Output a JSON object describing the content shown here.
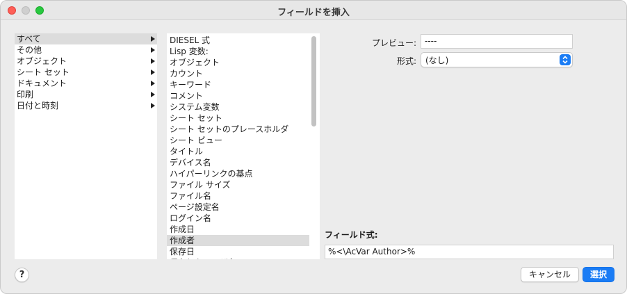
{
  "window": {
    "title": "フィールドを挿入"
  },
  "categories": [
    {
      "label": "すべて",
      "selected": true
    },
    {
      "label": "その他",
      "selected": false
    },
    {
      "label": "オブジェクト",
      "selected": false
    },
    {
      "label": "シート セット",
      "selected": false
    },
    {
      "label": "ドキュメント",
      "selected": false
    },
    {
      "label": "印刷",
      "selected": false
    },
    {
      "label": "日付と時刻",
      "selected": false
    }
  ],
  "fields": [
    {
      "label": "DIESEL 式",
      "selected": false
    },
    {
      "label": "Lisp 変数:",
      "selected": false
    },
    {
      "label": "オブジェクト",
      "selected": false
    },
    {
      "label": "カウント",
      "selected": false
    },
    {
      "label": "キーワード",
      "selected": false
    },
    {
      "label": "コメント",
      "selected": false
    },
    {
      "label": "システム変数",
      "selected": false
    },
    {
      "label": "シート セット",
      "selected": false
    },
    {
      "label": "シート セットのプレースホルダ",
      "selected": false
    },
    {
      "label": "シート ビュー",
      "selected": false
    },
    {
      "label": "タイトル",
      "selected": false
    },
    {
      "label": "デバイス名",
      "selected": false
    },
    {
      "label": "ハイパーリンクの基点",
      "selected": false
    },
    {
      "label": "ファイル サイズ",
      "selected": false
    },
    {
      "label": "ファイル名",
      "selected": false
    },
    {
      "label": "ページ設定名",
      "selected": false
    },
    {
      "label": "ログイン名",
      "selected": false
    },
    {
      "label": "作成日",
      "selected": false
    },
    {
      "label": "作成者",
      "selected": true
    },
    {
      "label": "保存日",
      "selected": false
    },
    {
      "label": "保存したユーザ名",
      "selected": false
    }
  ],
  "preview": {
    "label": "プレビュー:",
    "value": "----"
  },
  "format": {
    "label": "形式:",
    "value": "(なし)"
  },
  "expression": {
    "label": "フィールド式:",
    "value": "%<\\AcVar Author>%"
  },
  "buttons": {
    "help": "?",
    "cancel": "キャンセル",
    "ok": "選択"
  },
  "colors": {
    "accent": "#1a7cf5",
    "selection": "#dcdcdc"
  }
}
